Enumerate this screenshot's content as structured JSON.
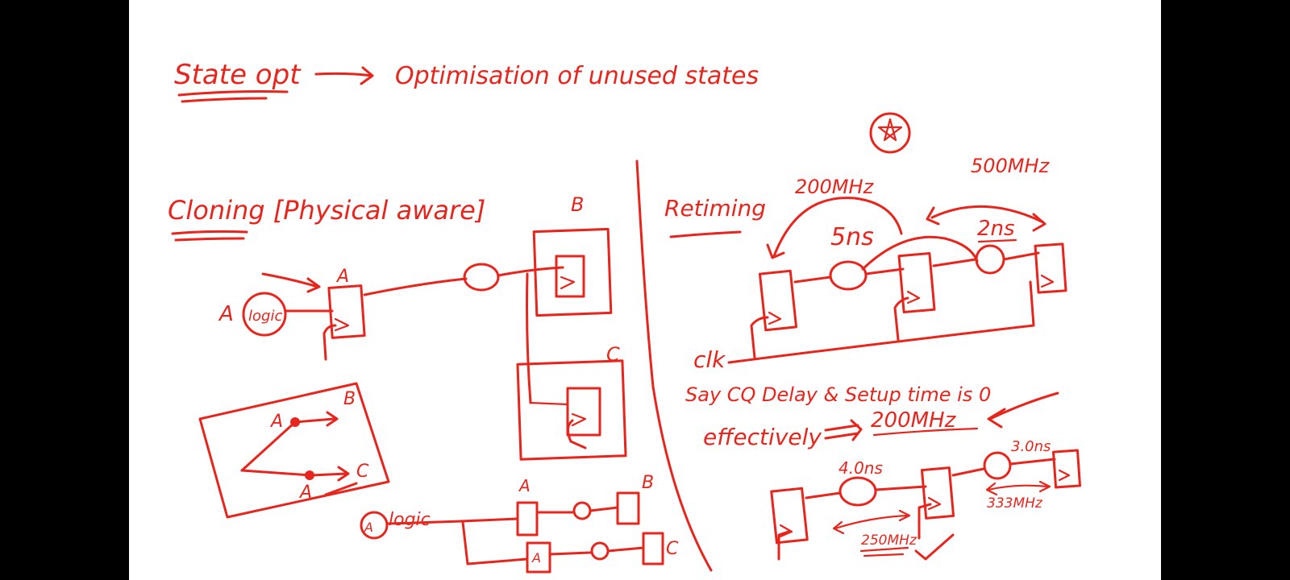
{
  "colors": {
    "ink": "#e8251c",
    "page": "#ffffff",
    "frame": "#000000"
  },
  "heading": {
    "term": "State opt",
    "description": "Optimisation of unused states"
  },
  "cloning": {
    "title": "Cloning [Physical aware]",
    "flop_a_label": "A",
    "driver_input_label": "A",
    "logic_label": "logic",
    "flop_b_label": "B",
    "flop_c_label": "C",
    "sketch": {
      "label_a_top": "A",
      "label_a_bottom": "A",
      "label_b": "B",
      "label_c": "C"
    },
    "cloned": {
      "input_label": "A",
      "logic_label": "logic",
      "flop_a_top_label": "A",
      "flop_a_bottom_label": "A",
      "flop_b_label": "B",
      "flop_c_label": "C"
    }
  },
  "retiming": {
    "title": "Retiming",
    "freq_left": "200MHz",
    "freq_right": "500MHz",
    "delay_left": "5ns",
    "delay_right": "2ns",
    "clk_label": "clk",
    "note_line": "Say CQ Delay & Setup time is 0",
    "effective_prefix": "effectively",
    "effective_freq": "200MHz",
    "after_delay_left": "4.0ns",
    "after_delay_right": "3.0ns",
    "after_freq_left": "250MHz",
    "after_freq_right": "333MHz"
  }
}
